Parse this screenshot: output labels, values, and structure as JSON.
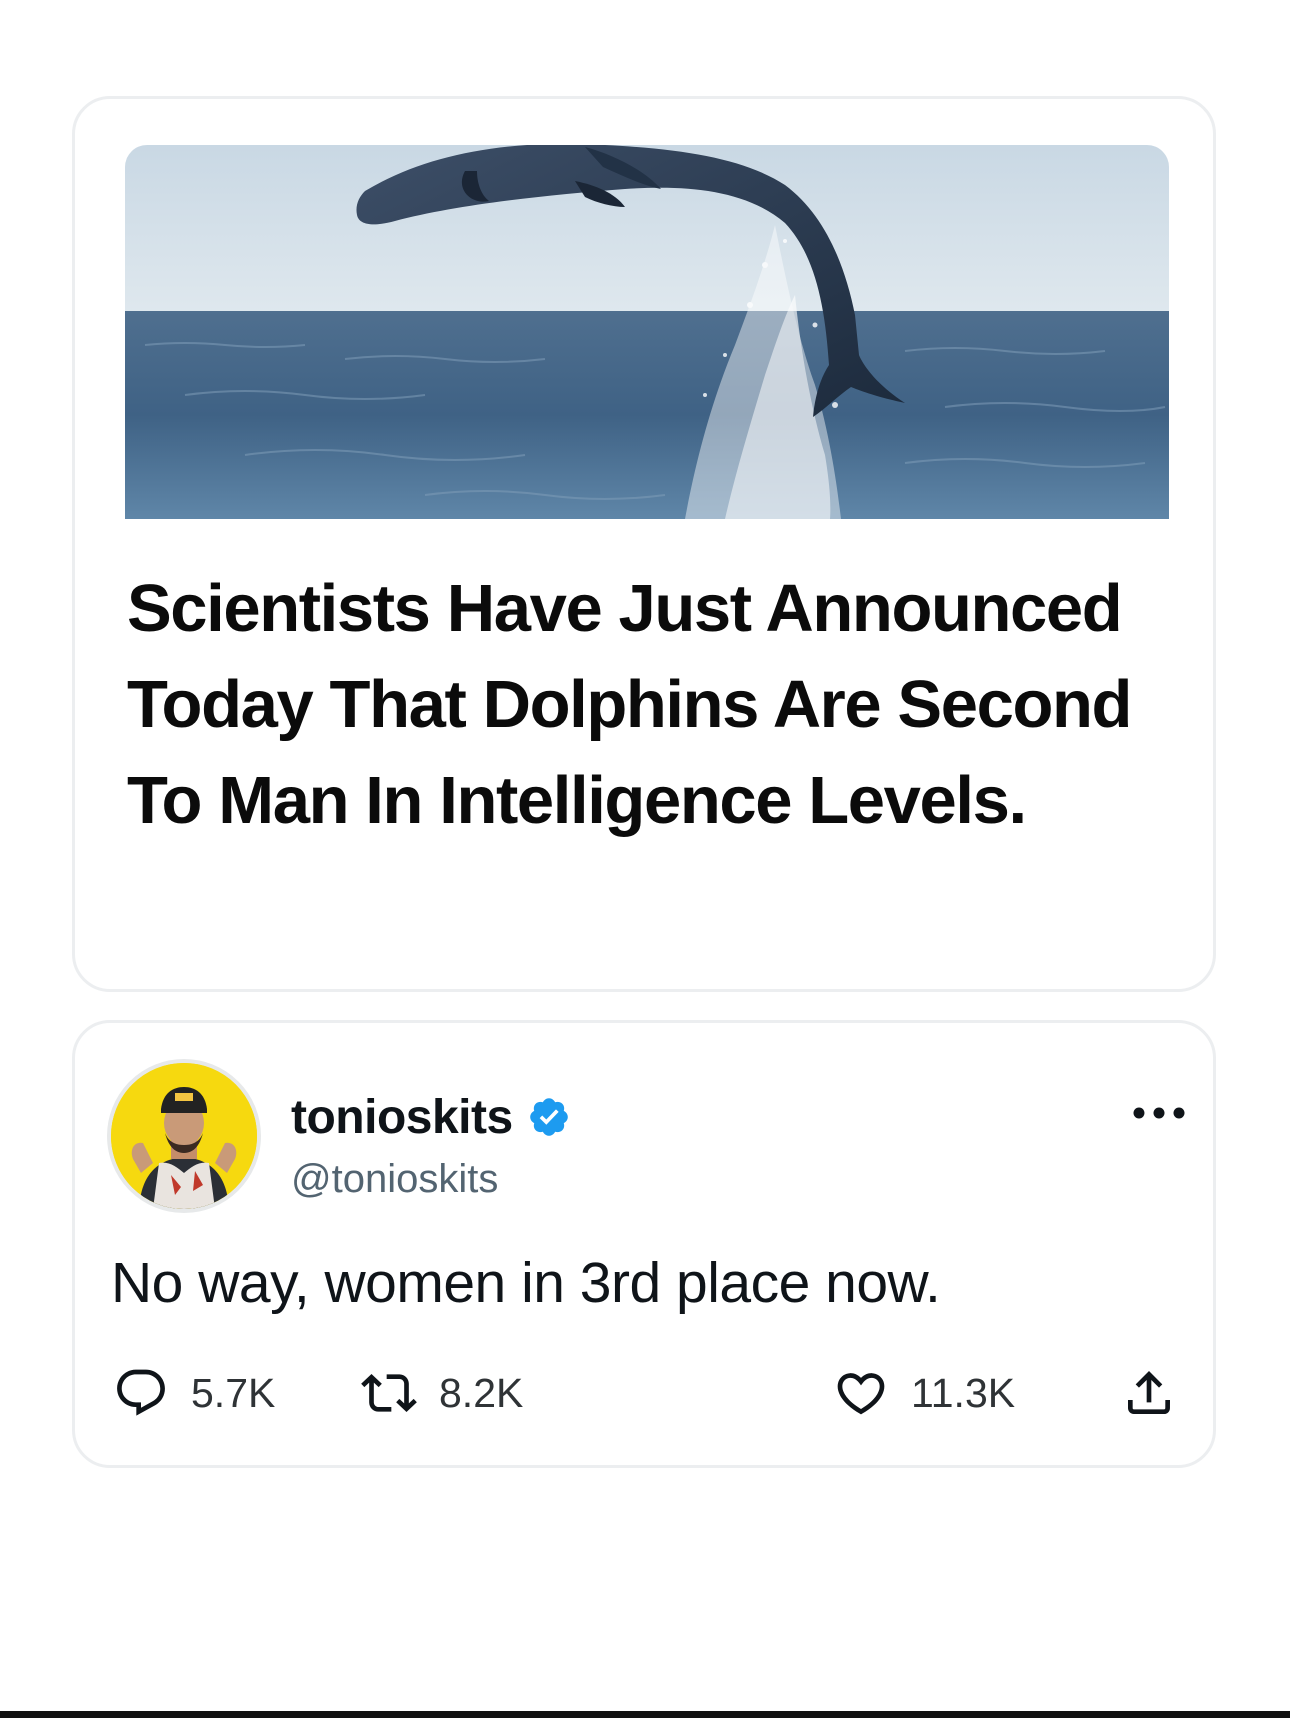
{
  "article": {
    "image_icon": "dolphin-jumping-photo",
    "headline": "Scientists Have Just Announced Today That Dolphins Are Second To Man In Intelligence Levels."
  },
  "tweet": {
    "avatar_icon": "user-avatar",
    "display_name": "tonioskits",
    "verified_icon": "verified-badge-icon",
    "verified_color": "#1d9bf0",
    "handle": "@tonioskits",
    "more_icon": "more-options-icon",
    "text": "No way, women in 3rd place now.",
    "actions": {
      "replies": {
        "icon": "reply-icon",
        "count": "5.7K"
      },
      "retweets": {
        "icon": "retweet-icon",
        "count": "8.2K"
      },
      "likes": {
        "icon": "heart-icon",
        "count": "11.3K"
      },
      "share": {
        "icon": "share-icon"
      }
    }
  },
  "colors": {
    "card_border": "#eceef0",
    "text_primary": "#0f1419",
    "text_secondary": "#536471",
    "avatar_background": "#f6d90f"
  }
}
